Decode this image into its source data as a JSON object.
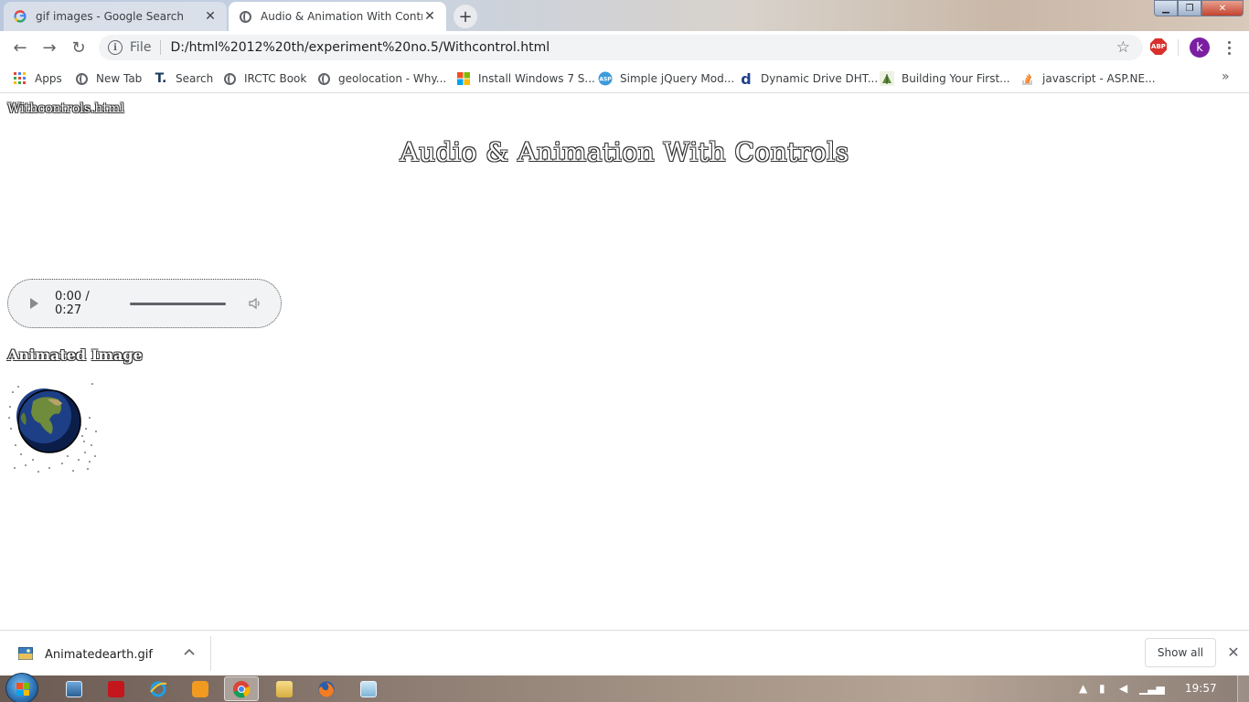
{
  "browser": {
    "tabs": [
      {
        "title": "gif images - Google Search",
        "favicon": "google-g-icon",
        "active": false
      },
      {
        "title": "Audio & Animation With Controls",
        "favicon": "globe-icon",
        "active": true
      }
    ],
    "new_tab_glyph": "+",
    "close_glyph": "✕",
    "window_controls": {
      "minimize": "▁",
      "maximize": "❐",
      "close": "✕"
    },
    "nav": {
      "back": "←",
      "forward": "→",
      "reload": "↻"
    },
    "omnibox": {
      "chip": "File",
      "url": "D:/html%2012%20th/experiment%20no.5/Withcontrol.html",
      "star": "☆"
    },
    "abp_label": "ABP",
    "profile_initial": "k",
    "bookmarks": [
      {
        "label": "Apps",
        "icon": "apps-grid-icon"
      },
      {
        "label": "New Tab",
        "icon": "globe-icon"
      },
      {
        "label": "Search",
        "icon": "t-logo-icon"
      },
      {
        "label": "IRCTC Book",
        "icon": "globe-icon"
      },
      {
        "label": "geolocation - Why...",
        "icon": "globe-icon"
      },
      {
        "label": "Install Windows 7 S...",
        "icon": "windows-logo-icon"
      },
      {
        "label": "Simple jQuery Mod...",
        "icon": "asp-icon"
      },
      {
        "label": "Dynamic Drive DHT...",
        "icon": "dynamic-drive-icon"
      },
      {
        "label": "Building Your First...",
        "icon": "leaf-icon"
      },
      {
        "label": "javascript - ASP.NE...",
        "icon": "stackoverflow-icon"
      }
    ],
    "bookmarks_overflow": "»"
  },
  "page": {
    "filename": "Withcontrols.html",
    "heading": "Audio & Animation With Controls",
    "audio": {
      "time": "0:00 / 0:27"
    },
    "anim_label": "Animated Image"
  },
  "downloads": {
    "file": "Animatedearth.gif",
    "chevron": "^",
    "show_all": "Show all",
    "close": "✕"
  },
  "taskbar": {
    "apps": [
      "explorer-window-icon",
      "acrobat-icon",
      "internet-explorer-icon",
      "media-player-icon",
      "chrome-icon",
      "folder-icon",
      "firefox-icon",
      "notepad-icon"
    ],
    "time": "19:57"
  },
  "colors": {
    "profile": "#7b1fa2",
    "abp": "#d8302c",
    "omnibox_bg": "#f1f3f4"
  }
}
